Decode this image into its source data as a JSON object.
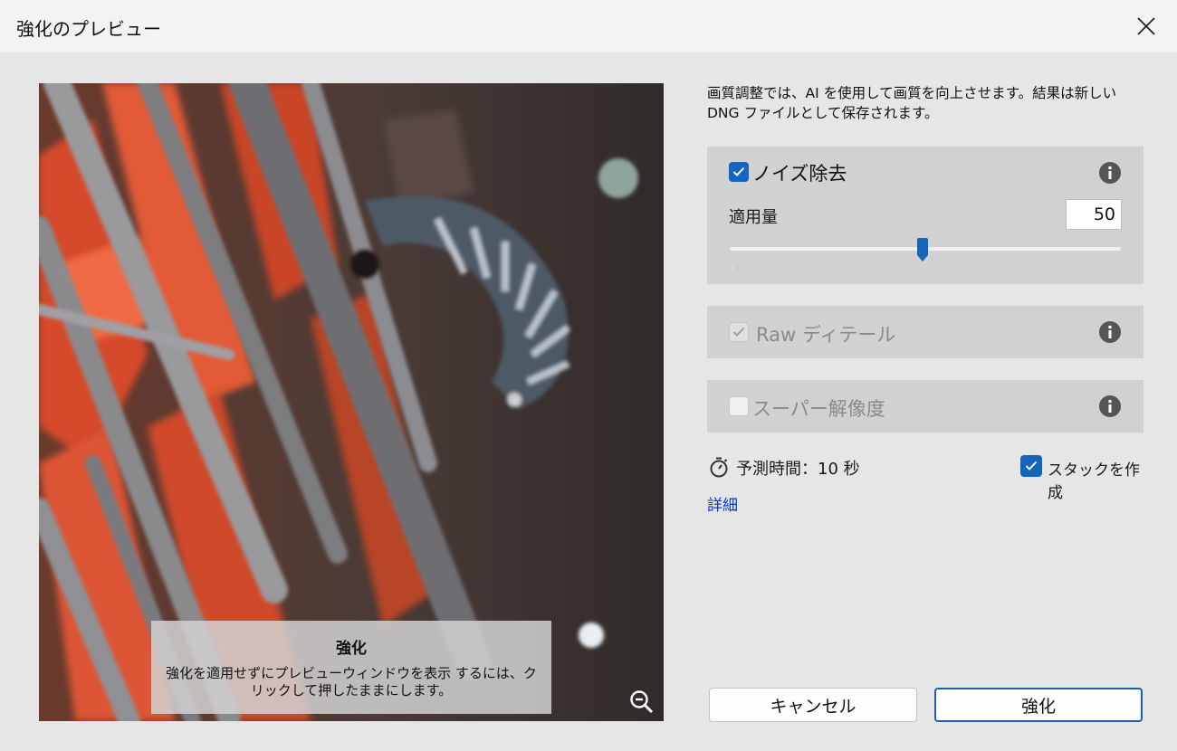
{
  "window": {
    "title": "強化のプレビュー"
  },
  "preview": {
    "tip_title": "強化",
    "tip_body": "強化を適用せずにプレビューウィンドウを表示 するには、クリックして押したままにします。"
  },
  "description": "画質調整では、AI を使用して画質を向上させます。結果は新しい DNG ファイルとして保存されます。",
  "noise": {
    "label": "ノイズ除去",
    "checked": true,
    "amount_label": "適用量",
    "amount_value": "50",
    "slider_fraction": 0.5
  },
  "raw_detail": {
    "label": "Raw ディテール",
    "checked": true,
    "disabled": true
  },
  "super_resolution": {
    "label": "スーパー解像度",
    "checked": false,
    "disabled": true
  },
  "predict": {
    "text": "予測時間：10 秒"
  },
  "stack": {
    "label": "スタックを作成",
    "checked": true
  },
  "details_link": "詳細",
  "buttons": {
    "cancel": "キャンセル",
    "enhance": "強化"
  },
  "colors": {
    "accent": "#1565c0",
    "link": "#0037d6"
  }
}
